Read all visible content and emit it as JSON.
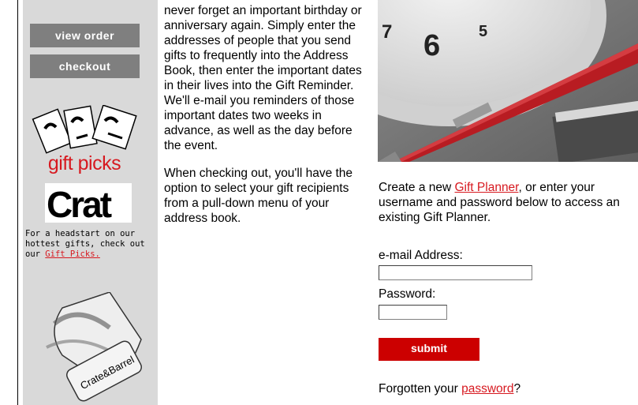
{
  "sidebar": {
    "view_order_label": "view order",
    "checkout_label": "checkout",
    "promo_title": "gift picks",
    "promo_logo_text": "Crat",
    "caption_prefix": "For a headstart on our hottest gifts, check out our ",
    "caption_link": "Gift Picks.",
    "ribbon_brand": "Crate&Barrel"
  },
  "main": {
    "paragraph1": "never forget an important birthday or anniversary again. Simply enter the addresses of people that you send gifts to frequently into the Address Book, then enter the important dates in their lives into the Gift Reminder. We'll e-mail you reminders of those important dates two weeks in advance, as well as the day before the event.",
    "paragraph2": "When checking out, you'll have the option to select your gift recipients from a pull-down menu of your address book."
  },
  "photo": {
    "clock_numbers": [
      "7",
      "6",
      "5"
    ]
  },
  "login": {
    "intro_prefix": "Create a new ",
    "intro_link": "Gift Planner",
    "intro_suffix": ", or enter your username and password below to access an existing Gift Planner.",
    "email_label": "e-mail Address:",
    "email_value": "",
    "password_label": "Password:",
    "password_value": "",
    "submit_label": "submit",
    "forgot_prefix": "Forgotten your ",
    "forgot_link": "password",
    "forgot_suffix": "?"
  },
  "colors": {
    "brand_red": "#d71920",
    "nav_gray": "#7f7f7f",
    "sidebar_bg": "#d9d9d9"
  }
}
